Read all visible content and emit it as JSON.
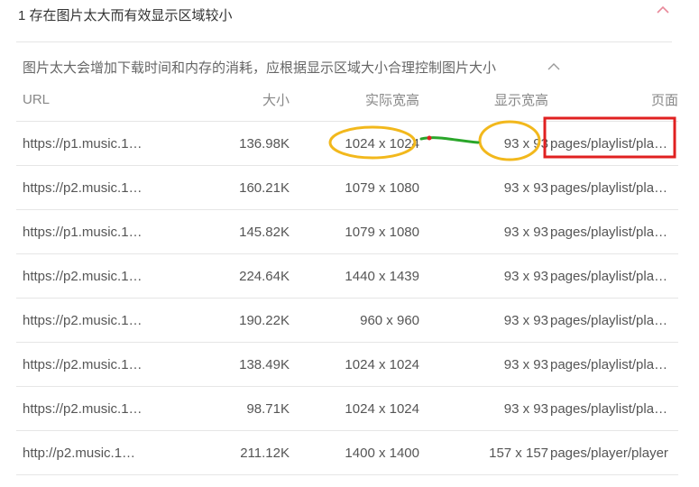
{
  "header": {
    "title": "1 存在图片太大而有效显示区域较小"
  },
  "description": "图片太大会增加下载时间和内存的消耗，应根据显示区域大小合理控制图片大小",
  "table": {
    "columns": {
      "url": "URL",
      "size": "大小",
      "actual": "实际宽高",
      "display": "显示宽高",
      "page": "页面"
    },
    "rows": [
      {
        "url": "https://p1.music.1…",
        "size": "136.98K",
        "actual": "1024 x 1024",
        "display": "93 x 93",
        "page": "pages/playlist/pla…"
      },
      {
        "url": "https://p2.music.1…",
        "size": "160.21K",
        "actual": "1079 x 1080",
        "display": "93 x 93",
        "page": "pages/playlist/pla…"
      },
      {
        "url": "https://p1.music.1…",
        "size": "145.82K",
        "actual": "1079 x 1080",
        "display": "93 x 93",
        "page": "pages/playlist/pla…"
      },
      {
        "url": "https://p2.music.1…",
        "size": "224.64K",
        "actual": "1440 x 1439",
        "display": "93 x 93",
        "page": "pages/playlist/pla…"
      },
      {
        "url": "https://p2.music.1…",
        "size": "190.22K",
        "actual": "960 x 960",
        "display": "93 x 93",
        "page": "pages/playlist/pla…"
      },
      {
        "url": "https://p2.music.1…",
        "size": "138.49K",
        "actual": "1024 x 1024",
        "display": "93 x 93",
        "page": "pages/playlist/pla…"
      },
      {
        "url": "https://p2.music.1…",
        "size": "98.71K",
        "actual": "1024 x 1024",
        "display": "93 x 93",
        "page": "pages/playlist/pla…"
      },
      {
        "url": "http://p2.music.1…",
        "size": "211.12K",
        "actual": "1400 x 1400",
        "display": "157 x 157",
        "page": "pages/player/player"
      }
    ]
  },
  "colors": {
    "link": "#1a8fd6",
    "chevron_accent": "#e8899a",
    "annotation_ellipse": "#f2b81c",
    "annotation_box": "#e02020",
    "annotation_arrow": "#2aa62a"
  },
  "icons": {
    "header_toggle": "chevron-up-icon",
    "description_toggle": "chevron-up-icon"
  }
}
